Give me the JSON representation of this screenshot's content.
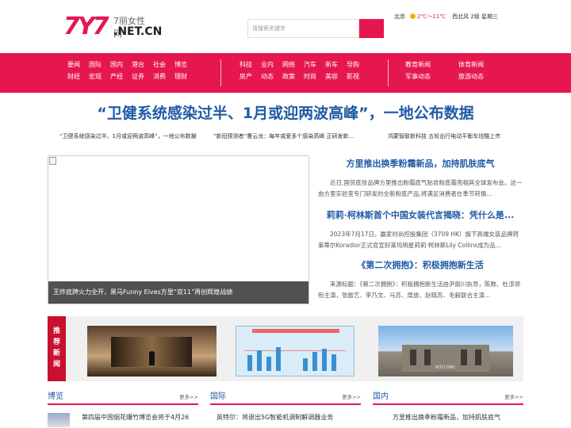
{
  "header": {
    "logo_mark": "7Y7",
    "logo_cn": "7丽女性网",
    "logo_net": ".NET.CN",
    "search_placeholder": "请搜索关键字",
    "weather": {
      "city": "北京",
      "temp": "2℃～11℃",
      "wind": "西北风 2级",
      "weekday": "星期三"
    }
  },
  "nav": {
    "group1": [
      "要闻",
      "国际",
      "国内",
      "港台",
      "社会",
      "博览",
      "财经",
      "宏观",
      "产经",
      "证券",
      "消费",
      "理财"
    ],
    "group2": [
      "科技",
      "业内",
      "网络",
      "汽车",
      "新车",
      "导购",
      "房产",
      "动态",
      "政策",
      "时尚",
      "美容",
      "影视"
    ],
    "group3": [
      "教育新闻",
      "体育新闻",
      "军事动态",
      "旅游动态"
    ]
  },
  "headline": "“卫健系统感染过半、1月或迎两波高峰”，一地公布数据",
  "sub_links": [
    "“卫健系统感染过半、1月或迎两波高峰”，一地公布数据",
    "“新冠预测者”曹云龙：每年或爱多个感染高峰 正研发新...",
    "鸿蒙智联新科技 五轮出行电动平衡车炫酷上市"
  ],
  "slider": {
    "caption": "王炸底牌火力全开，黑马Funny Elves方里“双11”再创辉煌战绩"
  },
  "articles": [
    {
      "title": "方里推出换季粉霜新品，加持肌肤底气",
      "desc": "近日,国货底妆品牌方里推出粉霜底气贴妆粉底霜亮相其全球发布会。这一由方里实验室专门研发的全新粉底产品,将满足消费者在季节转换..."
    },
    {
      "title": "莉莉·柯林斯首个中国女装代言揭晓：凭什么是...",
      "desc": "2023年7月17日，赢家时尚控股集团（3709 HK）旗下高端女装品牌珂莱蒂尔Koradior正式官宣好莱坞明星莉莉·柯林斯Lily Collins成为品..."
    },
    {
      "title": "《第二次拥抱》：积极拥抱新生活",
      "desc": "来源标题：《第二次拥抱》：积极拥抱新生活由尹丽川执导，陈数、杜淳领衔主演，张歆艺、李乃文、马苏、周放、赵晓苏、毛毅联合主演..."
    }
  ],
  "recommend": {
    "label": "推荐新闻",
    "wto_sign": "WTO OMC"
  },
  "sections": [
    {
      "title": "博览",
      "more": "更多>>",
      "item": "第四届中国烟花爆竹博览会将于4月26"
    },
    {
      "title": "国际",
      "more": "更多>>",
      "item": "英特尔：将退出5G智能机调制解调器业务"
    },
    {
      "title": "国内",
      "more": "更多>>",
      "item": "方里推出换季粉霜新品，加持肌肤底气"
    }
  ],
  "colors": {
    "brand": "#e6174f",
    "link_blue": "#1f5aa6",
    "rec_label": "#c9102f"
  }
}
